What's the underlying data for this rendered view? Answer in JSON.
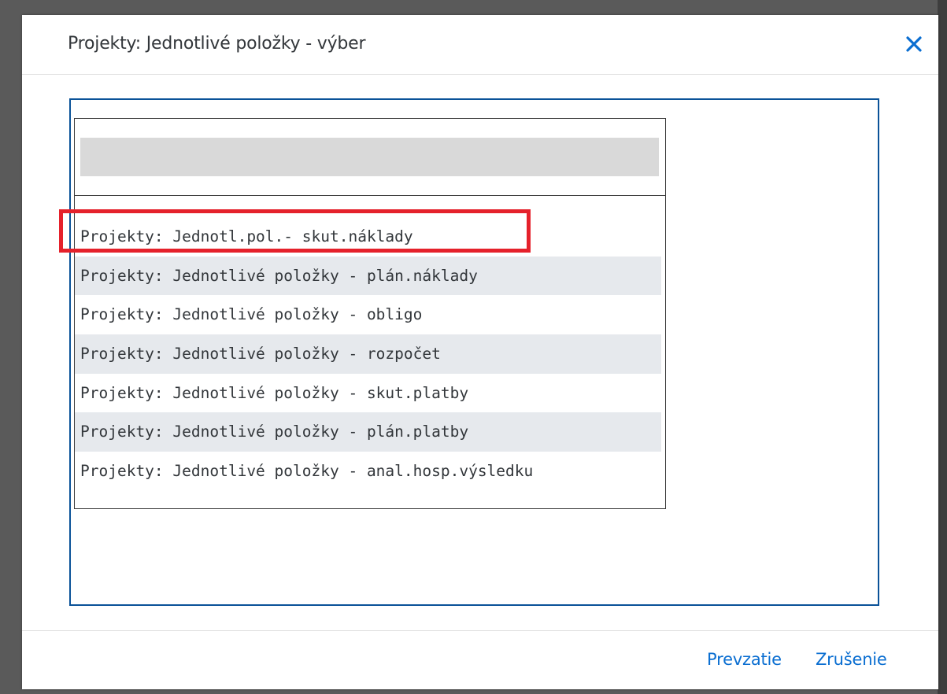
{
  "dialog": {
    "title": "Projekty: Jednotlivé položky - výber",
    "close_icon": "close-icon"
  },
  "search": {
    "value": ""
  },
  "list": {
    "items": [
      {
        "label": "Projekty: Jednotl.pol.- skut.náklady",
        "highlighted": true
      },
      {
        "label": "Projekty: Jednotlivé položky - plán.náklady"
      },
      {
        "label": "Projekty: Jednotlivé položky - obligo"
      },
      {
        "label": "Projekty: Jednotlivé položky - rozpočet"
      },
      {
        "label": "Projekty: Jednotlivé položky - skut.platby"
      },
      {
        "label": "Projekty: Jednotlivé položky - plán.platby"
      },
      {
        "label": "Projekty: Jednotlivé položky - anal.hosp.výsledku"
      }
    ]
  },
  "footer": {
    "accept_label": "Prevzatie",
    "cancel_label": "Zrušenie"
  },
  "colors": {
    "accent": "#0a6ed1",
    "frame_border": "#0a5298",
    "highlight": "#e5212b",
    "alt_row": "#e6e9ed"
  }
}
